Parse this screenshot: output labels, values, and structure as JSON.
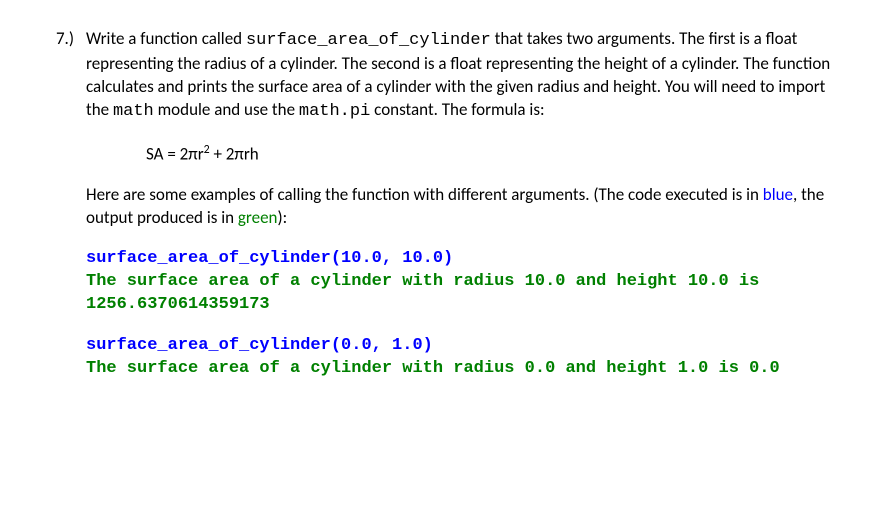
{
  "question": {
    "number": "7.)",
    "intro_1": "Write a function called ",
    "fn_name": "surface_area_of_cylinder",
    "intro_2": " that takes two arguments.  The first is a float representing the radius of a cylinder.  The second is a float representing the height of a cylinder.  The function calculates and prints the surface area of a cylinder with the given radius and height.  You will need to import the ",
    "module_name": "math",
    "intro_3": " module and use the ",
    "constant_name": "math.pi",
    "intro_4": " constant.  The formula is:",
    "formula": "SA = 2πr² + 2πrh",
    "examples_intro_1": "Here are some examples of calling the function with different arguments.  (The code executed is in ",
    "blue_word": "blue",
    "examples_intro_2": ", the output produced is in ",
    "green_word": "green",
    "examples_intro_3": "):",
    "example1_call": "surface_area_of_cylinder(10.0, 10.0)",
    "example1_out": "The surface area of a cylinder with radius 10.0 and height 10.0 is 1256.6370614359173",
    "example2_call": "surface_area_of_cylinder(0.0, 1.0)",
    "example2_out": "The surface area of a cylinder with radius 0.0 and height 1.0 is 0.0"
  }
}
